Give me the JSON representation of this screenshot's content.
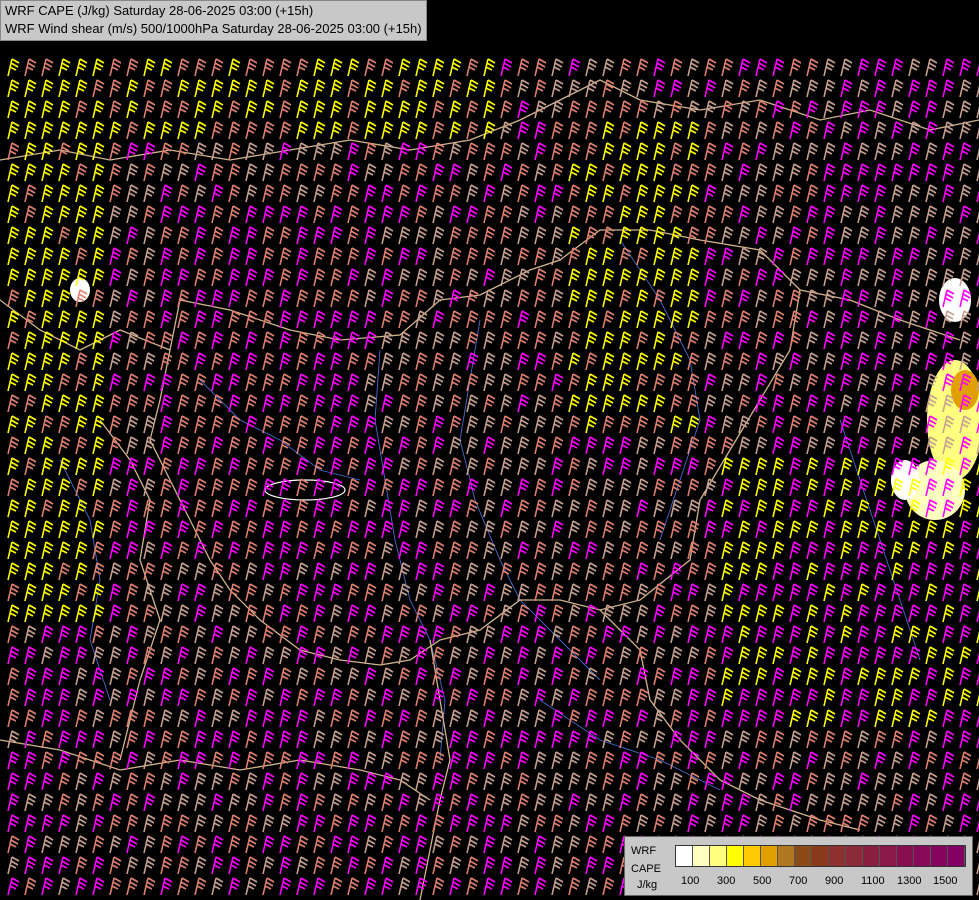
{
  "header": {
    "line1": "WRF CAPE (J/kg) Saturday 28-06-2025 03:00 (+15h)",
    "line2": "WRF Wind shear (m/s) 500/1000hPa Saturday 28-06-2025 03:00 (+15h)"
  },
  "legend": {
    "model": "WRF",
    "variable": "CAPE",
    "unit": "J/kg",
    "colors": [
      "#ffffff",
      "#ffffc0",
      "#ffff80",
      "#ffff00",
      "#ffc800",
      "#e0a000",
      "#b07820",
      "#8c4a18",
      "#8a3a1c",
      "#8c3030",
      "#8c2a3a",
      "#8a2040",
      "#8a1848",
      "#880e50",
      "#860a58",
      "#84045e",
      "#820064"
    ],
    "labels": [
      "100",
      "300",
      "500",
      "700",
      "900",
      "1100",
      "1300",
      "1500"
    ]
  },
  "barb_colors": {
    "strong": "#ff00ff",
    "yellow": "#ffff00",
    "salmon": "#e08070",
    "light": "#c8a090"
  },
  "map_colors": {
    "border": "#d2b48c",
    "river": "#4a6ad0",
    "background": "#000000"
  }
}
